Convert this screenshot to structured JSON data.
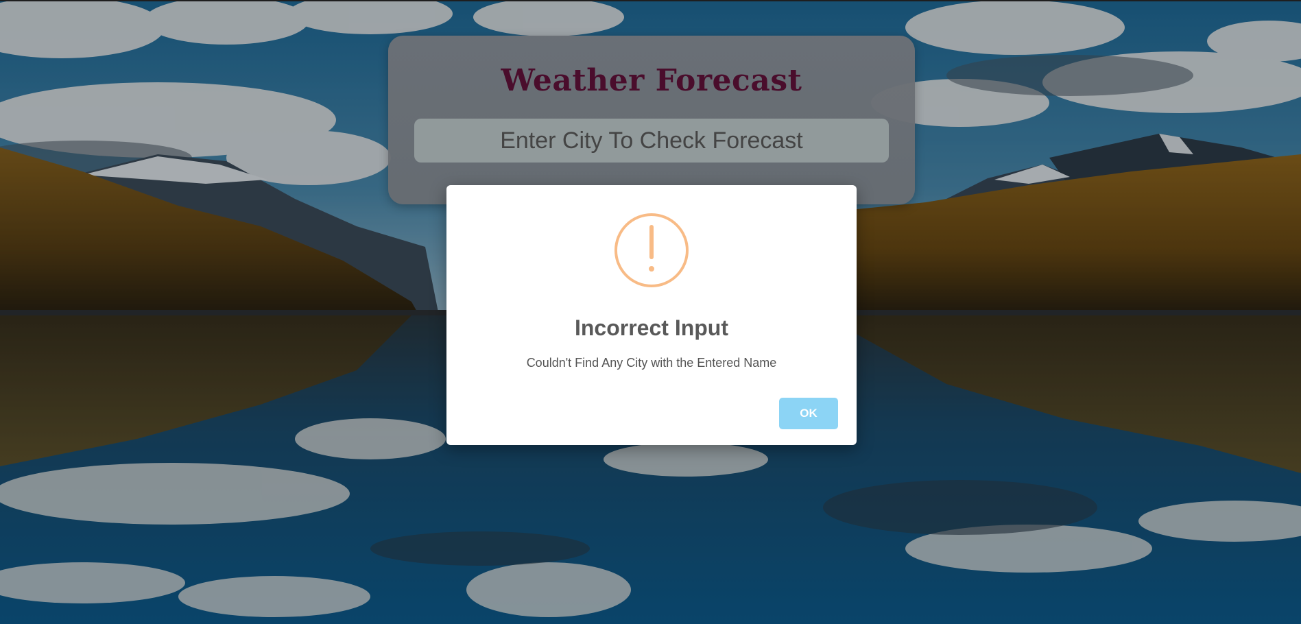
{
  "app": {
    "title": "Weather Forecast"
  },
  "search": {
    "placeholder": "Enter City To Check Forecast",
    "value": ""
  },
  "alert": {
    "icon": "warning-icon",
    "title": "Incorrect Input",
    "message": "Couldn't Find Any City with the Entered Name",
    "confirm_label": "OK"
  },
  "colors": {
    "title": "#4a0d2c",
    "warning": "#f8bb86",
    "confirm_button": "#8cd4f5"
  }
}
